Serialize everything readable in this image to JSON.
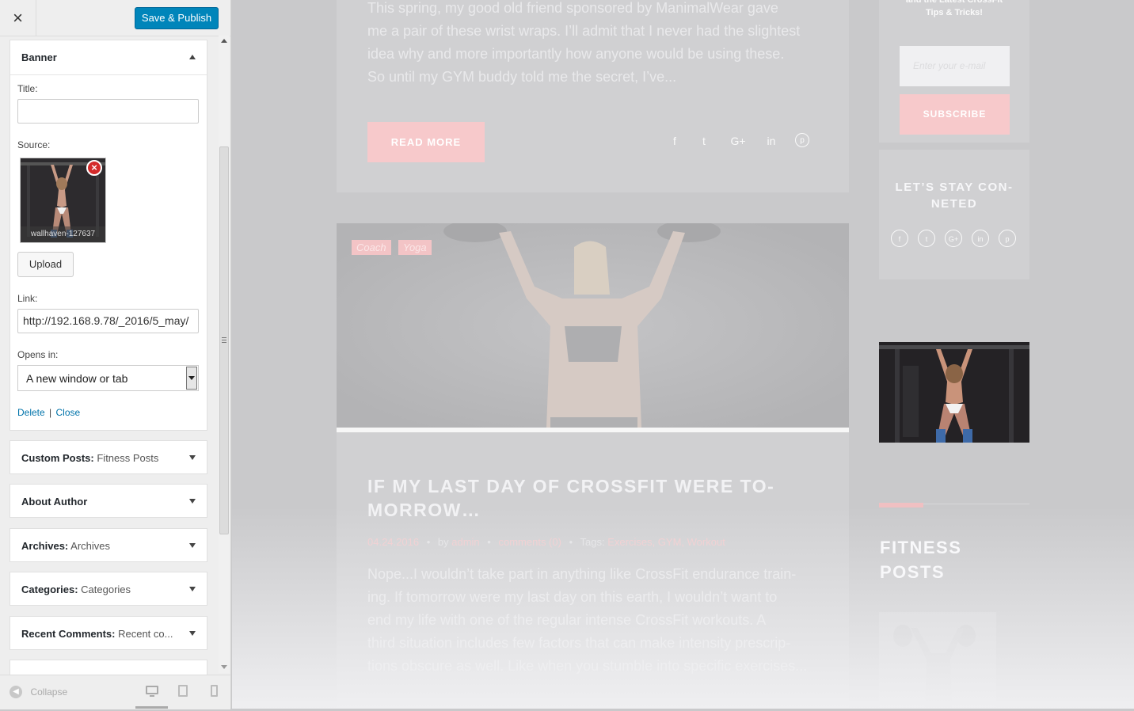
{
  "header": {
    "close_icon": "×",
    "save_label": "Save & Publish"
  },
  "banner_widget": {
    "title": "Banner",
    "title_label": "Title:",
    "title_value": "",
    "source_label": "Source:",
    "image_caption": "wallhaven-127637",
    "upload_label": "Upload",
    "link_label": "Link:",
    "link_value": "http://192.168.9.78/_2016/5_may/",
    "opens_label": "Opens in:",
    "opens_value": "A new window or tab",
    "delete_label": "Delete",
    "separator": "|",
    "close_label": "Close"
  },
  "widgets": [
    {
      "name": "Custom Posts:",
      "sub": "Fitness Posts"
    },
    {
      "name": "About Author",
      "sub": ""
    },
    {
      "name": "Archives:",
      "sub": "Archives"
    },
    {
      "name": "Categories:",
      "sub": "Categories"
    },
    {
      "name": "Recent Comments:",
      "sub": "Recent co..."
    }
  ],
  "footer": {
    "collapse_label": "Collapse"
  },
  "preview": {
    "post1_lines": [
      "This spring, my good old friend sponsored by ManimalWear gave",
      "me a pair of these wrist wraps. I’ll admit that I never had the slightest",
      "idea why and more importantly how anyone would be using these.",
      "So until my GYM buddy told me the secret, I’ve..."
    ],
    "read_more": "READ MORE",
    "share_icons": [
      "f",
      "t",
      "G+",
      "in",
      "p"
    ],
    "tags": [
      "Coach",
      "Yoga"
    ],
    "post2_title_lines": [
      "IF MY LAST DAY OF CROSSFIT WERE TO-",
      "MORROW…"
    ],
    "meta": {
      "date": "04.24.2016",
      "by": "by",
      "author": "admin",
      "comments": "comments (0)",
      "tags_label": "Tags:",
      "tags": "Exercises, GYM, Workout"
    },
    "post2_lines": [
      "Nope...I wouldn’t take part in anything like CrossFit endurance train-",
      "ing. If tomorrow were my last day on this earth, I wouldn’t want to",
      "end my life with one of the regular intense CrossFit workouts. A",
      "third situation includes few factors that can make intensity prescrip-",
      "tions obscure as well. Like when you stumble into specific exercises..."
    ],
    "sidebar": {
      "newsletter_lines": [
        "and the Latest CrossFit",
        "Tips & Tricks!"
      ],
      "email_placeholder": "Enter your e-mail",
      "subscribe": "SUBSCRIBE",
      "connect_lines": [
        "LET’S STAY CON-",
        "NETED"
      ],
      "connect_icons": [
        "f",
        "t",
        "G+",
        "in",
        "p"
      ],
      "fitness_lines": [
        "FITNESS",
        "POSTS"
      ]
    }
  }
}
